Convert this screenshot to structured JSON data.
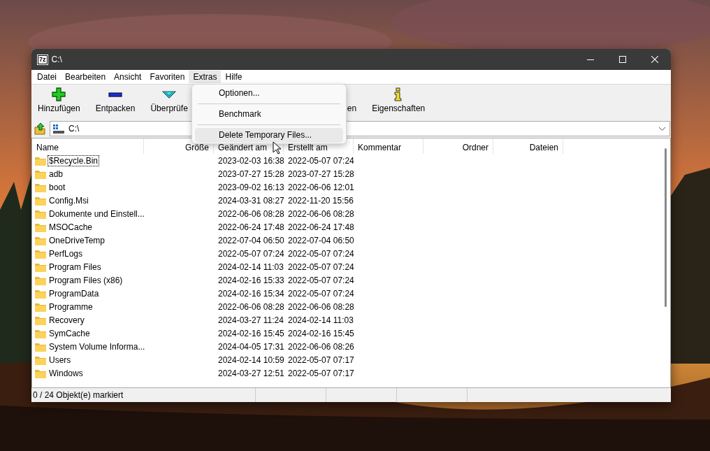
{
  "window": {
    "logo": "7z",
    "title": "C:\\"
  },
  "menu_bar": [
    {
      "label": "Datei",
      "selected": false
    },
    {
      "label": "Bearbeiten",
      "selected": false
    },
    {
      "label": "Ansicht",
      "selected": false
    },
    {
      "label": "Favoriten",
      "selected": false
    },
    {
      "label": "Extras",
      "selected": true
    },
    {
      "label": "Hilfe",
      "selected": false
    }
  ],
  "toolbar": [
    {
      "kind": "add",
      "label": "Hinzufügen"
    },
    {
      "kind": "extract",
      "label": "Entpacken"
    },
    {
      "kind": "test",
      "label": "Überprüfe"
    },
    {
      "kind": "covered",
      "label": "en"
    },
    {
      "kind": "info",
      "label": "Eigenschaften"
    }
  ],
  "address": {
    "value": "C:\\"
  },
  "table": {
    "columns": [
      {
        "label": "Name",
        "right_aligned": false
      },
      {
        "label": "Größe",
        "right_aligned": true
      },
      {
        "label": "Geändert am",
        "right_aligned": false
      },
      {
        "label": "Erstellt am",
        "right_aligned": false
      },
      {
        "label": "Kommentar",
        "right_aligned": false
      },
      {
        "label": "Ordner",
        "right_aligned": true
      },
      {
        "label": "Dateien",
        "right_aligned": true
      }
    ],
    "rows": [
      {
        "name": "$Recycle.Bin",
        "modified": "2023-02-03 16:38",
        "created": "2022-05-07 07:24",
        "focused": true
      },
      {
        "name": "adb",
        "modified": "2023-07-27 15:28",
        "created": "2023-07-27 15:28",
        "focused": false
      },
      {
        "name": "boot",
        "modified": "2023-09-02 16:13",
        "created": "2022-06-06 12:01",
        "focused": false
      },
      {
        "name": "Config.Msi",
        "modified": "2024-03-31 08:27",
        "created": "2022-11-20 15:56",
        "focused": false
      },
      {
        "name": "Dokumente und Einstell...",
        "modified": "2022-06-06 08:28",
        "created": "2022-06-06 08:28",
        "focused": false
      },
      {
        "name": "MSOCache",
        "modified": "2022-06-24 17:48",
        "created": "2022-06-24 17:48",
        "focused": false
      },
      {
        "name": "OneDriveTemp",
        "modified": "2022-07-04 06:50",
        "created": "2022-07-04 06:50",
        "focused": false
      },
      {
        "name": "PerfLogs",
        "modified": "2022-05-07 07:24",
        "created": "2022-05-07 07:24",
        "focused": false
      },
      {
        "name": "Program Files",
        "modified": "2024-02-14 11:03",
        "created": "2022-05-07 07:24",
        "focused": false
      },
      {
        "name": "Program Files (x86)",
        "modified": "2024-02-16 15:33",
        "created": "2022-05-07 07:24",
        "focused": false
      },
      {
        "name": "ProgramData",
        "modified": "2024-02-16 15:34",
        "created": "2022-05-07 07:24",
        "focused": false
      },
      {
        "name": "Programme",
        "modified": "2022-06-06 08:28",
        "created": "2022-06-06 08:28",
        "focused": false
      },
      {
        "name": "Recovery",
        "modified": "2024-03-27 11:24",
        "created": "2024-02-14 11:03",
        "focused": false
      },
      {
        "name": "SymCache",
        "modified": "2024-02-16 15:45",
        "created": "2024-02-16 15:45",
        "focused": false
      },
      {
        "name": "System Volume Informa...",
        "modified": "2024-04-05 17:31",
        "created": "2022-06-06 08:26",
        "focused": false
      },
      {
        "name": "Users",
        "modified": "2024-02-14 10:59",
        "created": "2022-05-07 07:17",
        "focused": false
      },
      {
        "name": "Windows",
        "modified": "2024-03-27 12:51",
        "created": "2022-05-07 07:17",
        "focused": false
      }
    ]
  },
  "dropdown_menu": [
    {
      "label": "Optionen...",
      "selected": false
    },
    {
      "label": "Benchmark",
      "selected": false
    },
    {
      "label": "Delete Temporary Files...",
      "selected": true
    }
  ],
  "status_bar": [
    "0 / 24 Objekt(e) markiert"
  ]
}
